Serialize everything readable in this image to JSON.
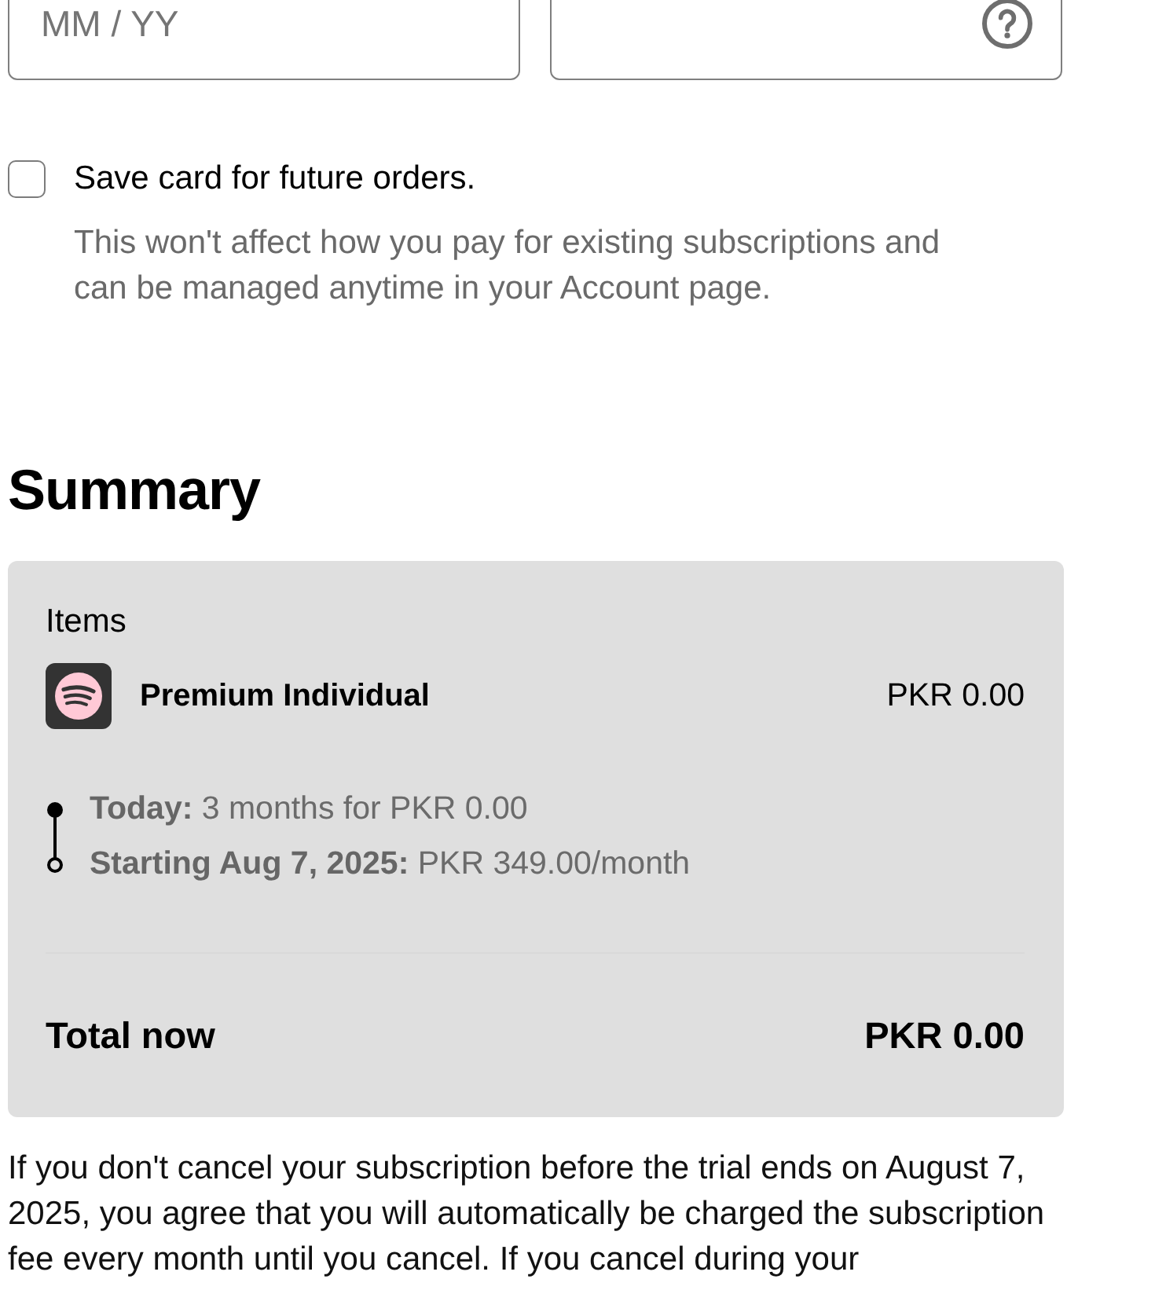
{
  "card_fields": [
    {
      "kind": "expiry",
      "placeholder": "MM / YY"
    },
    {
      "kind": "security_code"
    }
  ],
  "save_card": {
    "label": "Save card for future orders.",
    "checked": false,
    "note": "This won't affect how you pay for existing subscriptions and can be managed anytime in your Account page."
  },
  "summary": {
    "title": "Summary",
    "items_label": "Items",
    "items": [
      {
        "name": "Premium Individual",
        "price": "PKR 0.00"
      }
    ],
    "timeline": [
      {
        "kind": "current",
        "text": "**Today:** 3 months for PKR 0.00"
      },
      {
        "kind": "upcoming",
        "text": "**Starting Aug 7, 2025:** PKR 349.00/month"
      }
    ],
    "total": {
      "label": "Total now",
      "amount": "PKR 0.00"
    }
  },
  "terms": "If you don't cancel your subscription before the trial ends on August 7, 2025, you agree that you will automatically be charged the subscription fee every month until you cancel. If you cancel during your"
}
